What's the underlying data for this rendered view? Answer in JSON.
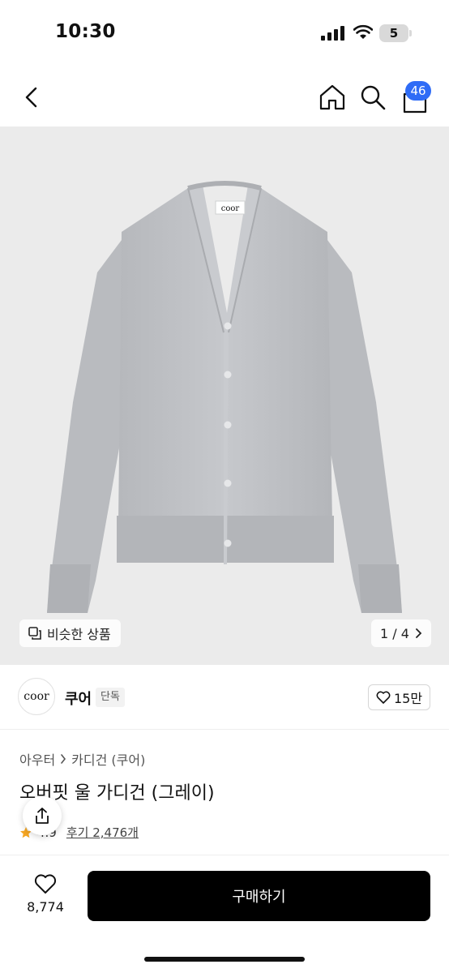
{
  "status_bar": {
    "time": "10:30",
    "battery": "5"
  },
  "nav": {
    "cart_count": "46",
    "icons": [
      "back-icon",
      "home-icon",
      "search-icon",
      "cart-icon"
    ]
  },
  "gallery": {
    "similar_label": "비슷한 상품",
    "pager": "1 / 4",
    "logo_tag": "coor"
  },
  "brand": {
    "logo_text": "coor",
    "name": "쿠어",
    "tag": "단독",
    "likes": "15만"
  },
  "product": {
    "breadcrumb": [
      "아우터",
      "카디건 (쿠어)"
    ],
    "title": "오버핏 울 가디건 (그레이)",
    "rating": "4.9",
    "reviews": "후기 2,476개"
  },
  "bottom": {
    "wish_count": "8,774",
    "buy_label": "구매하기"
  },
  "colors": {
    "accent_badge": "#2f6cf6",
    "buy_button": "#000000",
    "star": "#f5a623",
    "image_bg": "#ebebeb",
    "garment": "#bfc1c5"
  }
}
